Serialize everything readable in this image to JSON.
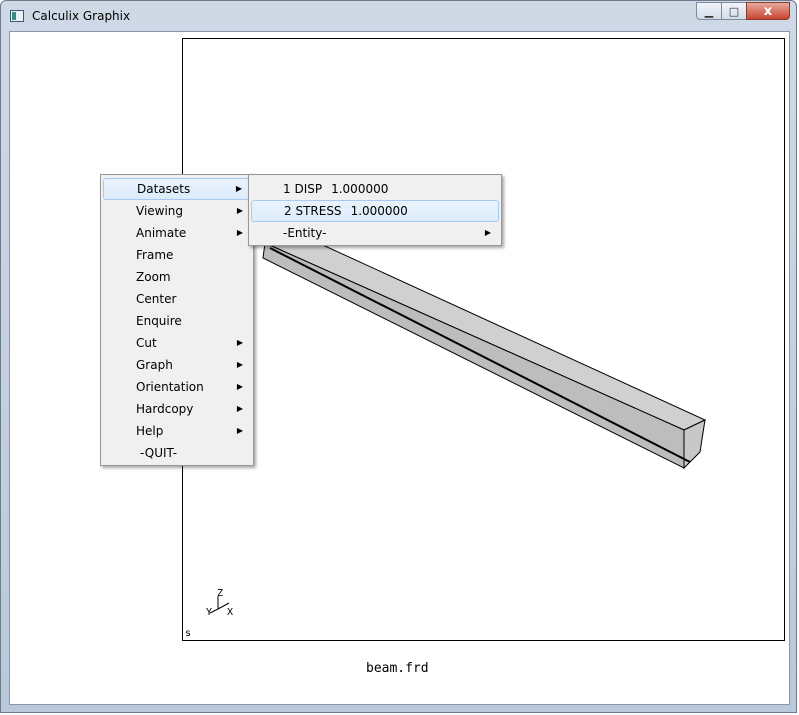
{
  "window": {
    "title": "Calculix Graphix",
    "minimize_glyph": "▁",
    "maximize_glyph": "□",
    "close_glyph": "x"
  },
  "viewport": {
    "corner_label": "s",
    "filename": "beam.frd",
    "axes": {
      "z": "Z",
      "y": "Y",
      "x": "X"
    }
  },
  "main_menu": {
    "items": [
      {
        "label": "Datasets",
        "submenu": true
      },
      {
        "label": "Viewing",
        "submenu": true
      },
      {
        "label": "Animate",
        "submenu": true
      },
      {
        "label": "Frame",
        "submenu": false
      },
      {
        "label": "Zoom",
        "submenu": false
      },
      {
        "label": "Center",
        "submenu": false
      },
      {
        "label": "Enquire",
        "submenu": false
      },
      {
        "label": "Cut",
        "submenu": true
      },
      {
        "label": "Graph",
        "submenu": true
      },
      {
        "label": "Orientation",
        "submenu": true
      },
      {
        "label": "Hardcopy",
        "submenu": true
      },
      {
        "label": "Help",
        "submenu": true
      },
      {
        "label": "-QUIT-",
        "submenu": false
      }
    ]
  },
  "datasets_menu": {
    "items": [
      {
        "label": "1 DISP",
        "value": "1.000000"
      },
      {
        "label": "2 STRESS",
        "value": "1.000000"
      },
      {
        "label": "-Entity-",
        "value": ""
      }
    ]
  },
  "colors": {
    "beam_face": "#bdbdbd",
    "beam_top": "#d2d2d2",
    "menu_highlight": "#dcebfb"
  }
}
